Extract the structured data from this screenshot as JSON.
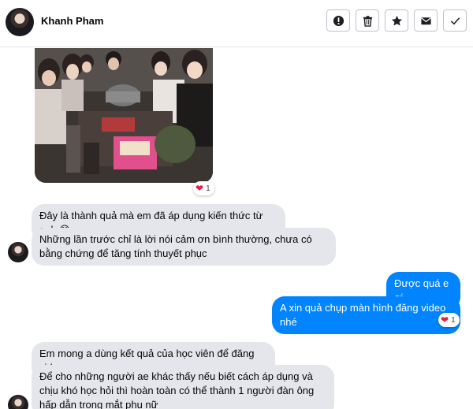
{
  "header": {
    "contact_name": "Khanh Pham"
  },
  "toolbar": [
    {
      "name": "report-button",
      "icon": "exclamation-circle-icon"
    },
    {
      "name": "delete-button",
      "icon": "trash-icon"
    },
    {
      "name": "star-button",
      "icon": "star-icon"
    },
    {
      "name": "mail-button",
      "icon": "envelope-icon"
    },
    {
      "name": "done-button",
      "icon": "checkmark-icon"
    }
  ],
  "messages": {
    "photo_reaction": {
      "emoji": "❤️",
      "count": "1"
    },
    "in_1": "Đây là thành quả mà em đã áp dụng kiến thức từ anh 😊",
    "in_2": "Những lần trước chỉ là lời nói cảm ơn bình thường, chưa có bằng chứng để tăng tính thuyết phục",
    "out_1": "Được quá e ơi",
    "out_2": "A xin quả chụp màn hình đăng video nhé",
    "out_2_reaction": {
      "emoji": "❤️",
      "count": "1"
    },
    "in_3": "Em mong a dùng kết quả của học viên để đăng video",
    "in_4": "Để cho những người ae khác thấy nếu biết cách áp dụng và chịu khó học hỏi thì hoàn toàn có thể thành 1 người đàn ông hấp dẫn trong mắt phụ nữ"
  },
  "colors": {
    "outgoing_bubble": "#0084ff",
    "incoming_bubble": "#e4e6eb",
    "heart": "#e41e3f"
  }
}
